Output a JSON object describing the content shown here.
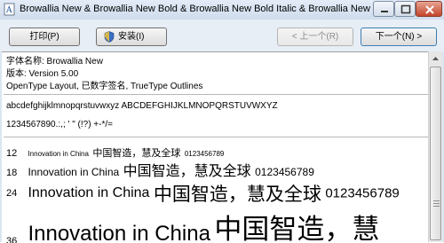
{
  "window": {
    "title": "Browallia New & Browallia New Bold & Browallia New Bold Italic & Browallia New ..."
  },
  "toolbar": {
    "print_label": "打印(P)",
    "install_label": "安装(I)",
    "prev_label": "< 上一个(R)",
    "next_label": "下一个(N) >"
  },
  "font_info": {
    "name_line": "字体名称: Browallia New",
    "version_line": "版本: Version 5.00",
    "features_line": "OpenType Layout, 已数字签名, TrueType Outlines"
  },
  "charset": {
    "letters": "abcdefghijklmnopqrstuvwxyz ABCDEFGHIJKLMNOPQRSTUVWXYZ",
    "digits": "1234567890.:,; ' \" (!?) +-*/="
  },
  "samples": [
    {
      "size": "12",
      "text": "Innovation in China",
      "cjk": "中国智造，慧及全球",
      "digits": "0123456789"
    },
    {
      "size": "18",
      "text": "Innovation in China",
      "cjk": "中国智造，慧及全球",
      "digits": "0123456789"
    },
    {
      "size": "24",
      "text": "Innovation in China",
      "cjk": "中国智造，慧及全球",
      "digits": "0123456789"
    },
    {
      "size": "36",
      "text": "Innovation in China",
      "cjk": "中国智造，慧",
      "digits": ""
    }
  ]
}
